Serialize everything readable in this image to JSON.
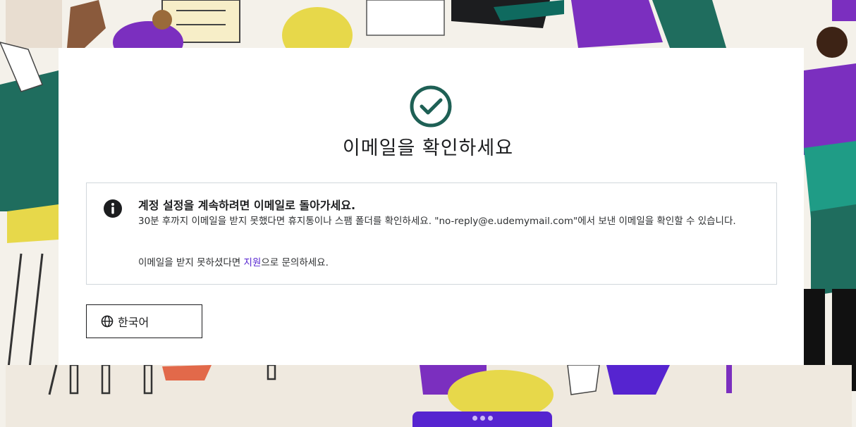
{
  "colors": {
    "success": "#1e6055",
    "brand_purple": "#5624d0",
    "text": "#1c1d1f",
    "teal": "#1f6d5e",
    "yellow": "#e7d84a"
  },
  "icons": {
    "success": "check-circle-icon",
    "info": "info-circle-icon",
    "language": "globe-icon"
  },
  "modal": {
    "title": "이메일을 확인하세요",
    "alert": {
      "heading": "계정 설정을 계속하려면 이메일로 돌아가세요.",
      "body": "30분 후까지 이메일을 받지 못했다면 휴지통이나 스팸 폴더를 확인하세요. \"no-reply@e.udemymail.com\"에서 보낸 이메일을 확인할 수 있습니다.",
      "contact_prefix": "이메일을 받지 못하셨다면 ",
      "contact_link": "지원",
      "contact_suffix": "으로 문의하세요."
    },
    "language_button": "한국어"
  }
}
